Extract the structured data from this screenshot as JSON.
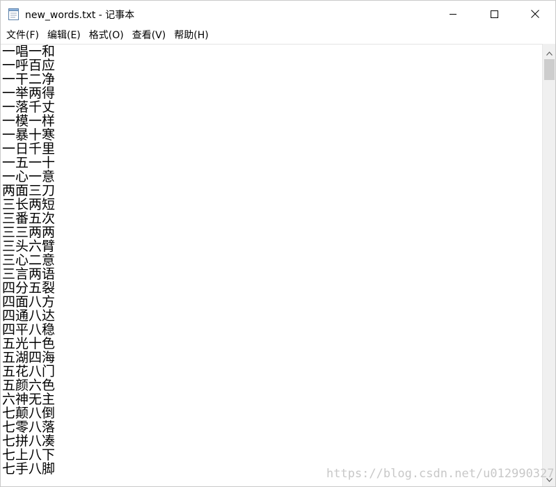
{
  "window": {
    "title": "new_words.txt - 记事本",
    "icon": "notepad-icon"
  },
  "controls": {
    "minimize_icon": "minimize-icon",
    "maximize_icon": "maximize-icon",
    "close_icon": "close-icon"
  },
  "menu": [
    {
      "label": "文件(F)"
    },
    {
      "label": "编辑(E)"
    },
    {
      "label": "格式(O)"
    },
    {
      "label": "查看(V)"
    },
    {
      "label": "帮助(H)"
    }
  ],
  "content": {
    "lines": [
      "一唱一和",
      "一呼百应",
      "一干二净",
      "一举两得",
      "一落千丈",
      "一模一样",
      "一暴十寒",
      "一日千里",
      "一五一十",
      "一心一意",
      "两面三刀",
      "三长两短",
      "三番五次",
      "三三两两",
      "三头六臂",
      "三心二意",
      "三言两语",
      "四分五裂",
      "四面八方",
      "四通八达",
      "四平八稳",
      "五光十色",
      "五湖四海",
      "五花八门",
      "五颜六色",
      "六神无主",
      "七颠八倒",
      "七零八落",
      "七拼八凑",
      "七上八下",
      "七手八脚"
    ]
  },
  "watermark": "https://blog.csdn.net/u012990327"
}
